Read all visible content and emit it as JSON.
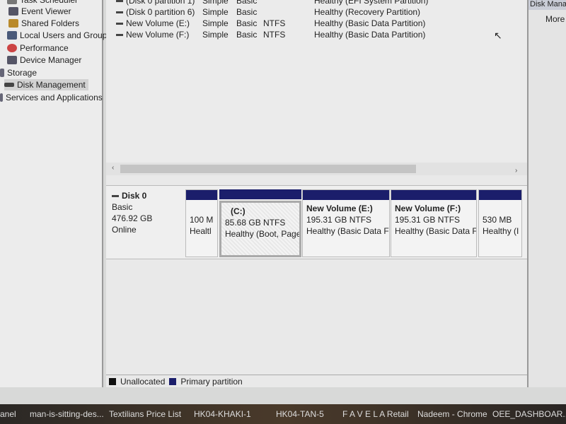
{
  "nav": {
    "items": [
      {
        "label": "Task Scheduler",
        "icon": "task-scheduler-icon"
      },
      {
        "label": "Event Viewer",
        "icon": "event-viewer-icon"
      },
      {
        "label": "Shared Folders",
        "icon": "shared-folders-icon"
      },
      {
        "label": "Local Users and Groups",
        "icon": "users-icon"
      },
      {
        "label": "Performance",
        "icon": "performance-icon"
      },
      {
        "label": "Device Manager",
        "icon": "device-manager-icon"
      },
      {
        "label": "Storage",
        "icon": "storage-icon"
      },
      {
        "label": "Disk Management",
        "icon": "disk-icon",
        "selected": true
      },
      {
        "label": "Services and Applications",
        "icon": "services-icon"
      }
    ]
  },
  "volumes": [
    {
      "name": "(Disk 0 partition 1)",
      "layout": "Simple",
      "type": "Basic",
      "fs": "",
      "status": "Healthy (EFI System Partition)"
    },
    {
      "name": "(Disk 0 partition 6)",
      "layout": "Simple",
      "type": "Basic",
      "fs": "",
      "status": "Healthy (Recovery Partition)"
    },
    {
      "name": "New Volume (E:)",
      "layout": "Simple",
      "type": "Basic",
      "fs": "NTFS",
      "status": "Healthy (Basic Data Partition)"
    },
    {
      "name": "New Volume (F:)",
      "layout": "Simple",
      "type": "Basic",
      "fs": "NTFS",
      "status": "Healthy (Basic Data Partition)"
    }
  ],
  "disk": {
    "name": "Disk 0",
    "type": "Basic",
    "size": "476.92 GB",
    "status": "Online",
    "partitions": [
      {
        "title": "",
        "size": "100 M",
        "status": "Healtl"
      },
      {
        "title": "(C:)",
        "size": "85.68 GB NTFS",
        "status": "Healthy (Boot, Page",
        "selected": true
      },
      {
        "title": "New Volume  (E:)",
        "size": "195.31 GB NTFS",
        "status": "Healthy (Basic Data F"
      },
      {
        "title": "New Volume  (F:)",
        "size": "195.31 GB NTFS",
        "status": "Healthy (Basic Data F"
      },
      {
        "title": "",
        "size": "530 MB",
        "status": "Healthy (I"
      }
    ]
  },
  "legend": [
    {
      "label": "Unallocated",
      "color": "#111111"
    },
    {
      "label": "Primary partition",
      "color": "#1b1e6b"
    }
  ],
  "actions": {
    "header": "Disk Manage",
    "more": "More"
  },
  "taskbar": [
    "anel",
    "man-is-sitting-des...",
    "Textilians Price List",
    "HK04-KHAKI-1",
    "HK04-TAN-5",
    "F A V E L A  Retail",
    "Nadeem - Chrome",
    "OEE_DASHBOAR..."
  ]
}
